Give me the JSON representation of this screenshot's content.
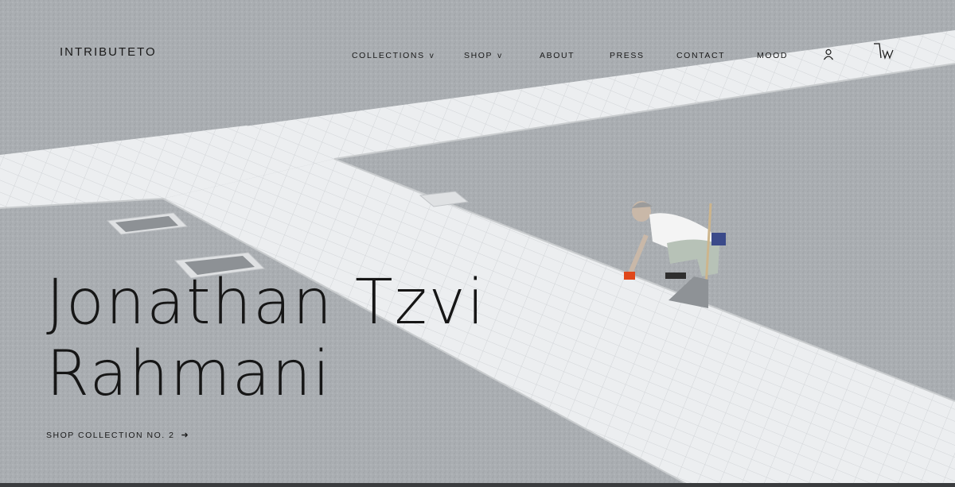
{
  "brand": {
    "logo_text": "INTRIBUTETO"
  },
  "nav": {
    "collections": "COLLECTIONS",
    "shop": "SHOP",
    "about": "ABOUT",
    "press": "PRESS",
    "contact": "CONTACT",
    "mood": "MOOD",
    "caret_glyph": "v",
    "account_icon": "user-icon",
    "cart_icon": "cart-icon"
  },
  "hero": {
    "title_line1": "Jonathan Tzvi",
    "title_line2": "Rahmani",
    "cta_label": "SHOP COLLECTION NO. 2",
    "cta_arrow": "➜",
    "image_description_icon": "hero-photo"
  },
  "colors": {
    "text": "#1a1a1a",
    "gravel": "#a9adb1",
    "pavement": "#e8eaec"
  }
}
